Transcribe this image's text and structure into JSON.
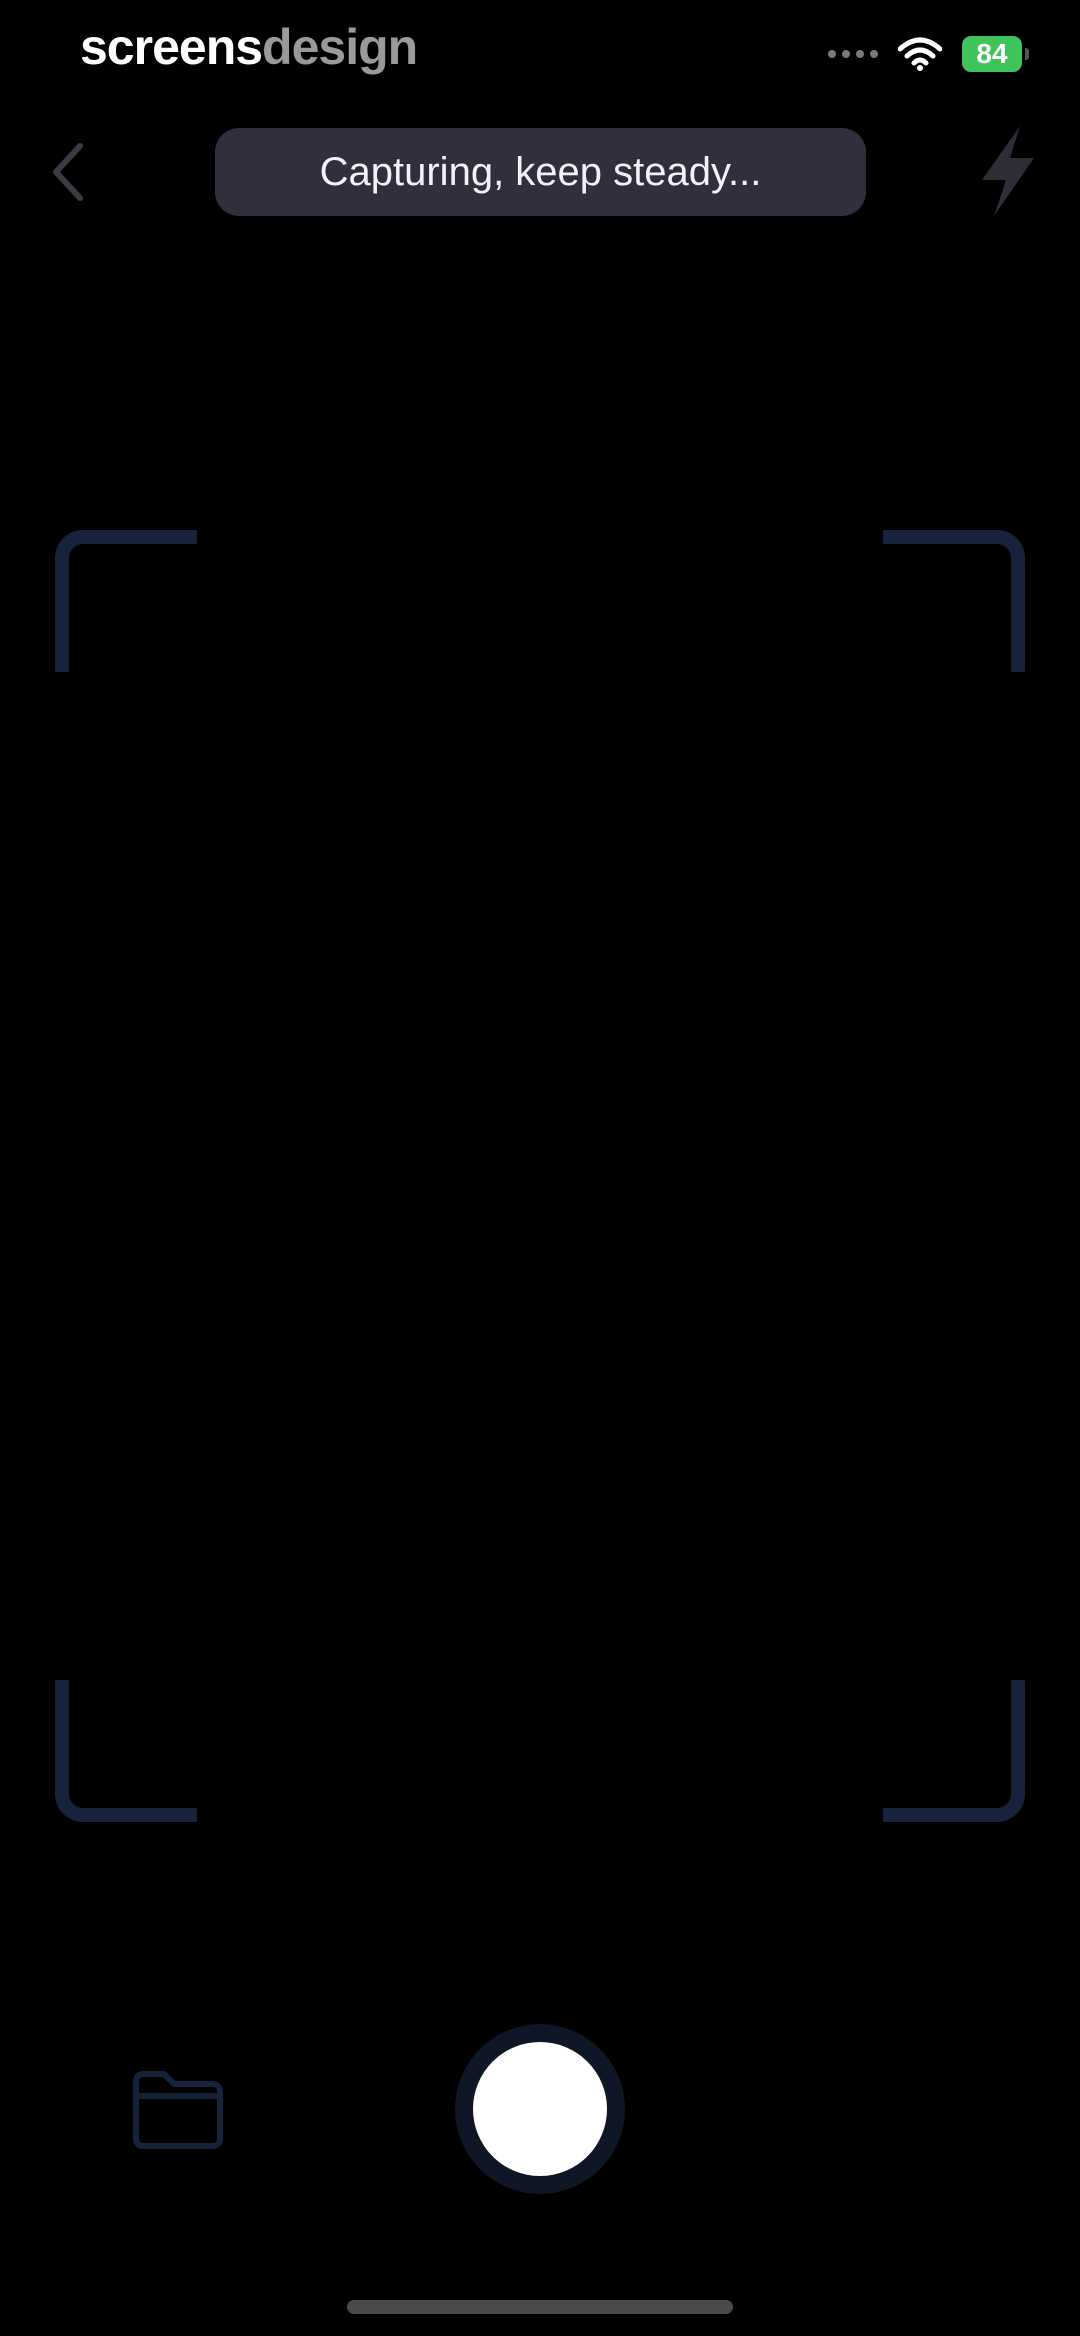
{
  "status_bar": {
    "watermark_part1": "screens",
    "watermark_part2": "design",
    "battery_level": "84",
    "icons": [
      "signal-dots-icon",
      "wifi-icon",
      "battery-icon"
    ]
  },
  "top_bar": {
    "back_icon": "chevron-left-icon",
    "toast_text": "Capturing, keep steady...",
    "flash_icon": "lightning-bolt-icon"
  },
  "bottom_bar": {
    "folder_icon": "folder-icon",
    "shutter": "shutter-button"
  },
  "colors": {
    "background": "#000000",
    "toast_bg": "#2f2f3d",
    "frame_corner": "#17233a",
    "battery": "#3ec45a",
    "shutter_ring": "#0f1626"
  }
}
